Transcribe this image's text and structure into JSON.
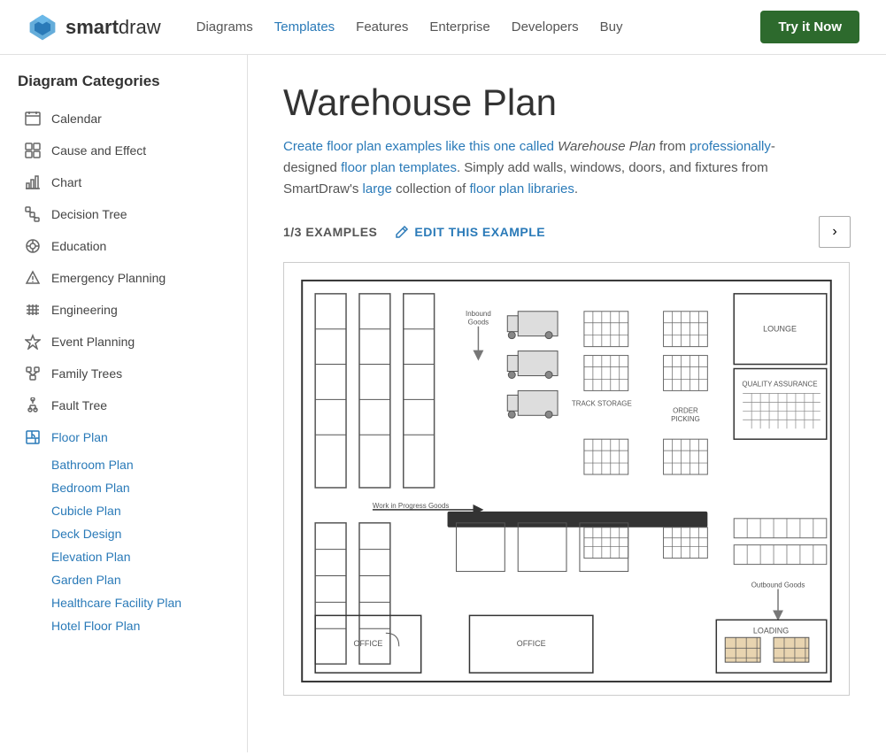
{
  "header": {
    "logo_smart": "smart",
    "logo_draw": "draw",
    "nav": [
      {
        "label": "Diagrams",
        "active": false
      },
      {
        "label": "Templates",
        "active": true
      },
      {
        "label": "Features",
        "active": false
      },
      {
        "label": "Enterprise",
        "active": false
      },
      {
        "label": "Developers",
        "active": false
      },
      {
        "label": "Buy",
        "active": false
      }
    ],
    "try_button": "Try it Now"
  },
  "sidebar": {
    "title": "Diagram Categories",
    "items": [
      {
        "label": "Calendar",
        "icon": "☰"
      },
      {
        "label": "Cause and Effect",
        "icon": "⊞"
      },
      {
        "label": "Chart",
        "icon": "▦"
      },
      {
        "label": "Decision Tree",
        "icon": "❖"
      },
      {
        "label": "Education",
        "icon": "✿"
      },
      {
        "label": "Emergency Planning",
        "icon": "⚠"
      },
      {
        "label": "Engineering",
        "icon": "≋"
      },
      {
        "label": "Event Planning",
        "icon": "✦"
      },
      {
        "label": "Family Trees",
        "icon": "⊡"
      },
      {
        "label": "Fault Tree",
        "icon": "⌂"
      },
      {
        "label": "Floor Plan",
        "icon": "⊘",
        "active": true
      }
    ],
    "sub_items": [
      {
        "label": "Bathroom Plan",
        "active": false
      },
      {
        "label": "Bedroom Plan",
        "active": false
      },
      {
        "label": "Cubicle Plan",
        "active": false
      },
      {
        "label": "Deck Design",
        "active": false
      },
      {
        "label": "Elevation Plan",
        "active": false
      },
      {
        "label": "Garden Plan",
        "active": false
      },
      {
        "label": "Healthcare Facility Plan",
        "active": false
      },
      {
        "label": "Hotel Floor Plan",
        "active": false
      }
    ]
  },
  "content": {
    "title": "Warehouse Plan",
    "description_parts": [
      "Create floor plan examples like this one called ",
      "Warehouse Plan",
      " from professionally-designed floor plan templates. Simply add walls, windows, doors, and fixtures from SmartDraw's large collection of floor plan libraries."
    ],
    "example_count": "1/3 EXAMPLES",
    "edit_label": "EDIT THIS EXAMPLE",
    "next_arrow": "›"
  }
}
